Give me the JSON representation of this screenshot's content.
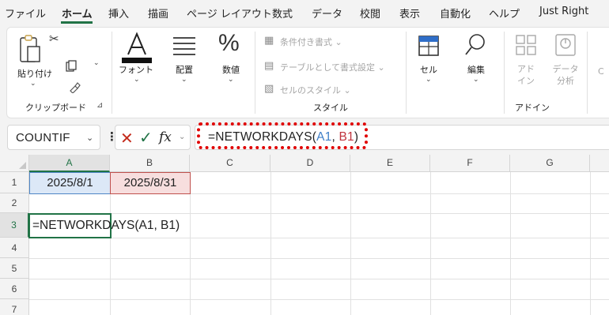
{
  "menu": {
    "items": [
      "ファイル",
      "ホーム",
      "挿入",
      "描画",
      "ページ レイアウト",
      "数式",
      "データ",
      "校閲",
      "表示",
      "自動化",
      "ヘルプ",
      "Just Right"
    ],
    "active": "ホーム"
  },
  "ribbon": {
    "paste_label": "貼り付け",
    "font_label": "フォント",
    "align_label": "配置",
    "number_label": "数値",
    "conditional_format": "条件付き書式 ⌄",
    "format_as_table": "テーブルとして書式設定 ⌄",
    "cell_styles": "セルのスタイル ⌄",
    "cells_label": "セル",
    "editing_label": "編集",
    "addin_label": "アド\nイン",
    "data_analysis_label": "データ\n分析",
    "group_clipboard": "クリップボード",
    "group_styles": "スタイル",
    "group_addins": "アドイン"
  },
  "formula_bar": {
    "name_box": "COUNTIF",
    "formula_prefix": "=NETWORKDAYS(",
    "ref1": "A1",
    "sep": ", ",
    "ref2": "B1",
    "formula_suffix": ")",
    "fx": "fx"
  },
  "grid": {
    "columns": [
      "A",
      "B",
      "C",
      "D",
      "E",
      "F",
      "G"
    ],
    "rows": [
      "1",
      "2",
      "3",
      "4",
      "5",
      "6",
      "7"
    ],
    "a1": "2025/8/1",
    "b1": "2025/8/31",
    "a3": "=NETWORKDAYS(A1, B1)"
  },
  "colors": {
    "accent": "#217346",
    "ref_a": "#3f7fc8",
    "ref_b": "#c0343e",
    "highlight": "#e00000"
  }
}
